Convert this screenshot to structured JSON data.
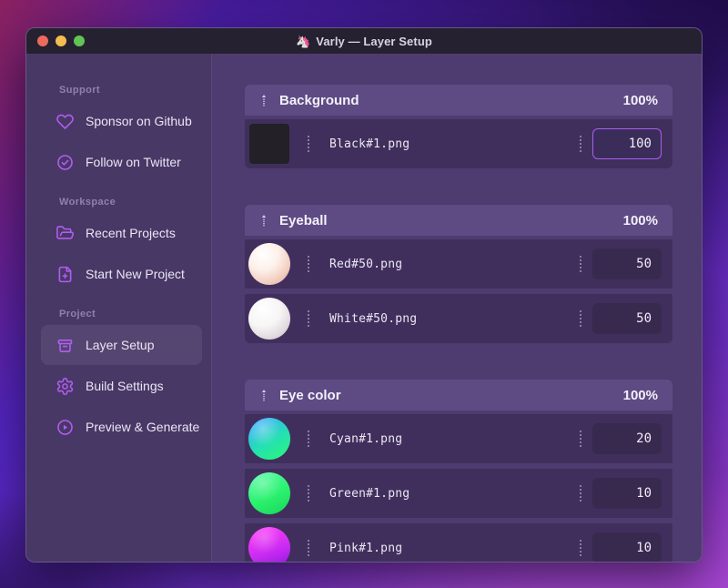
{
  "window": {
    "title": "Varly — Layer Setup",
    "app_icon": "🦄",
    "traffic_lights": [
      "close",
      "minimize",
      "zoom"
    ]
  },
  "colors": {
    "accent_purple": "#a65ff2",
    "icon_purple": "#b35cf2",
    "titlebar_bg": "#252130",
    "sidebar_bg": "#483866",
    "main_bg": "#4e3c70",
    "group_header_bg": "#5e4b84",
    "row_bg": "#402f5d",
    "input_bg": "#38294f",
    "traffic_red": "#ee6a5f",
    "traffic_yellow": "#f5bd4f",
    "traffic_green": "#61c454"
  },
  "sidebar": {
    "sections": [
      {
        "label": "Support",
        "items": [
          {
            "icon": "heart-icon",
            "label": "Sponsor on Github"
          },
          {
            "icon": "badge-check-icon",
            "label": "Follow on Twitter"
          }
        ]
      },
      {
        "label": "Workspace",
        "items": [
          {
            "icon": "folder-open-icon",
            "label": "Recent Projects"
          },
          {
            "icon": "file-plus-icon",
            "label": "Start New Project"
          }
        ]
      },
      {
        "label": "Project",
        "items": [
          {
            "icon": "archive-box-icon",
            "label": "Layer Setup",
            "active": true
          },
          {
            "icon": "gear-icon",
            "label": "Build Settings"
          },
          {
            "icon": "play-circle-icon",
            "label": "Preview & Generate"
          }
        ]
      }
    ]
  },
  "main": {
    "groups": [
      {
        "name": "Background",
        "percent": "100%",
        "layers": [
          {
            "thumbnail": "black-square",
            "file": "Black#1.png",
            "value": "100",
            "focused": true
          }
        ]
      },
      {
        "name": "Eyeball",
        "percent": "100%",
        "layers": [
          {
            "thumbnail": "red-ball",
            "file": "Red#50.png",
            "value": "50",
            "focused": false
          },
          {
            "thumbnail": "white-ball",
            "file": "White#50.png",
            "value": "50",
            "focused": false
          }
        ]
      },
      {
        "name": "Eye color",
        "percent": "100%",
        "layers": [
          {
            "thumbnail": "cyan-ball",
            "file": "Cyan#1.png",
            "value": "20",
            "focused": false
          },
          {
            "thumbnail": "green-ball",
            "file": "Green#1.png",
            "value": "10",
            "focused": false
          },
          {
            "thumbnail": "pink-ball",
            "file": "Pink#1.png",
            "value": "10",
            "focused": false
          }
        ]
      }
    ]
  }
}
